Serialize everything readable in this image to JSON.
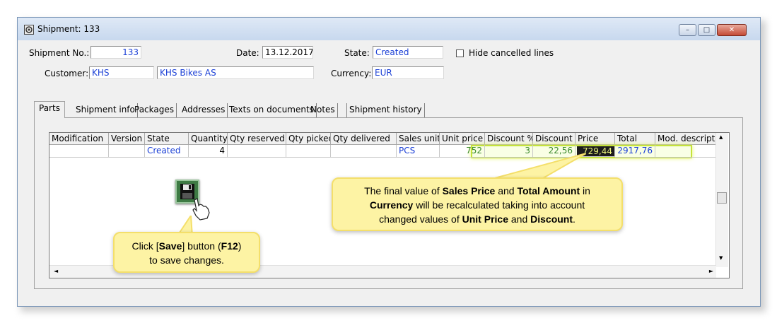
{
  "window": {
    "title": "Shipment: 133",
    "buttons": {
      "minimize": "–",
      "maximize": "□",
      "close": "✕"
    }
  },
  "header": {
    "shipment_no_label": "Shipment No.:",
    "shipment_no": "133",
    "date_label": "Date:",
    "date": "13.12.2017",
    "state_label": "State:",
    "state": "Created",
    "hide_cancelled_label": "Hide cancelled lines",
    "hide_cancelled_checked": false,
    "customer_label": "Customer:",
    "customer_code": "KHS",
    "customer_name": "KHS Bikes AS",
    "currency_label": "Currency:",
    "currency": "EUR"
  },
  "tabs": [
    {
      "label": "Parts",
      "active": true
    },
    {
      "label": "Shipment info"
    },
    {
      "label": "Packages"
    },
    {
      "label": "Addresses"
    },
    {
      "label": "Texts on documents"
    },
    {
      "label": "Notes"
    },
    {
      "label": "Shipment history"
    }
  ],
  "grid": {
    "columns": [
      "Modification",
      "Version",
      "State",
      "Quantity",
      "Qty reserved",
      "Qty picked",
      "Qty delivered",
      "Sales unit",
      "Unit price",
      "Discount %",
      "Discount",
      "Price",
      "Total",
      "Mod. descriptio"
    ],
    "rows": [
      {
        "modification": "",
        "version": "",
        "state": "Created",
        "quantity": "4",
        "qty_reserved": "",
        "qty_picked": "",
        "qty_delivered": "",
        "sales_unit": "PCS",
        "unit_price": "752",
        "discount_pct": "3",
        "discount": "22,56",
        "price": "729,44",
        "total": "2917,76",
        "mod_description": ""
      }
    ],
    "scroll_up": "▲",
    "scroll_down": "▼",
    "scroll_left": "◄",
    "scroll_right": "►"
  },
  "callouts": {
    "save": {
      "parts": [
        "Click [",
        "Save",
        "] button (",
        "F12",
        ")",
        "to save changes."
      ]
    },
    "price": {
      "parts": [
        "The final value of ",
        "Sales Price",
        " and ",
        "Total Amount",
        " in",
        "Currency",
        " will be recalculated taking into account",
        "changed values of ",
        "Unit Price",
        " and ",
        "Discount",
        "."
      ]
    }
  },
  "colors": {
    "highlight": "#c5e33a",
    "callout_bg": "#fdf3a4",
    "link_blue": "#1a3fd6",
    "value_green": "#3c8c2d"
  }
}
